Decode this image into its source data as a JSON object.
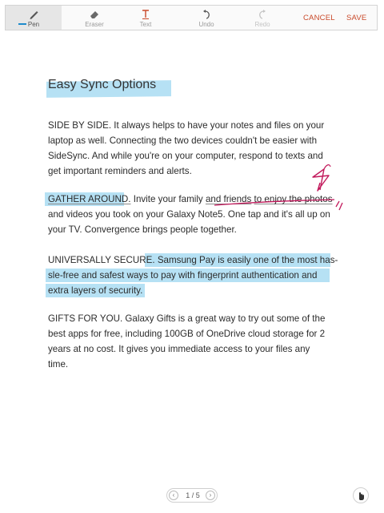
{
  "toolbar": {
    "tools": [
      {
        "label": "Pen",
        "icon": "pen-icon",
        "active": true
      },
      {
        "label": "Eraser",
        "icon": "eraser-icon",
        "active": false
      },
      {
        "label": "Text",
        "icon": "text-icon",
        "active": false
      },
      {
        "label": "Undo",
        "icon": "undo-icon",
        "active": false
      },
      {
        "label": "Redo",
        "icon": "redo-icon",
        "active": false
      }
    ],
    "cancel_label": "CANCEL",
    "save_label": "SAVE",
    "accent_color": "#c94a2a",
    "pen_color": "#1e8bcb"
  },
  "document": {
    "title": "Easy Sync Options",
    "p1": {
      "lines": [
        "SIDE BY SIDE. It always helps to have your notes and files on your",
        "laptop as well. Connecting the two devices couldn't be easier with",
        "SideSync. And while you're on your computer, respond to texts and",
        "get important reminders and alerts."
      ]
    },
    "p2": {
      "l1_heading": "GATHER AROUND.",
      "l1_mid": " Invite your family ",
      "l1_u1": "and friends",
      "l1_sp": " ",
      "l1_u2": "to enjoy the photos",
      "l2": "and videos you took on your Galaxy Note5. One tap and it's all up on",
      "l3": "your TV. Convergence brings people together."
    },
    "p3": {
      "l1_a": "UNIVERSALLY SECURE. ",
      "l1_b": "Samsung Pay is easily one of the most has-",
      "l2": "sle-free and safest ways to pay with fingerprint authentication and",
      "l3": "extra layers of security."
    },
    "p4": {
      "lines": [
        "GIFTS FOR YOU. Galaxy Gifts is a great way to try out some of the",
        "best apps for free, including 100GB of OneDrive cloud storage for 2",
        "years at no cost. It gives you immediate access to your files any",
        "time."
      ]
    },
    "highlight_color": "#a9dcf2",
    "ink_color": "#c2185b"
  },
  "pager": {
    "prev_icon": "chevron-left-icon",
    "text": "1 / 5",
    "next_icon": "chevron-right-icon"
  },
  "floating_icon": "hand-pointer-icon"
}
